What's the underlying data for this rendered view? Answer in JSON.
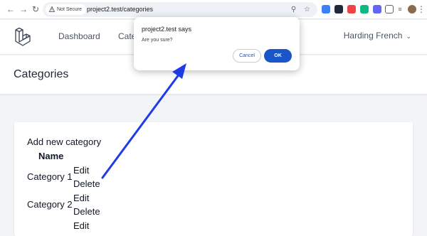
{
  "browser": {
    "security_label": "Not Secure",
    "url": "project2.test/categories",
    "icons": [
      "back-icon",
      "forward-icon",
      "reload-icon",
      "zoom-icon",
      "bookmark-star-icon",
      "extensions-icon",
      "profile-avatar-icon",
      "menu-kebab-icon"
    ]
  },
  "header": {
    "nav": [
      "Dashboard",
      "Cate"
    ],
    "user_name": "Harding French"
  },
  "page": {
    "title": "Categories"
  },
  "content": {
    "add_link": "Add new category",
    "column_name": "Name",
    "rows": [
      {
        "name": "Category 1",
        "edit": "Edit",
        "delete": "Delete"
      },
      {
        "name": "Category 2",
        "edit": "Edit",
        "delete": "Delete"
      },
      {
        "name": "",
        "edit": "Edit",
        "delete": ""
      }
    ]
  },
  "dialog": {
    "title": "project2.test says",
    "message": "Are you sure?",
    "cancel_label": "Cancel",
    "ok_label": "OK"
  },
  "annotation": {
    "arrow_color": "#1f3be8"
  },
  "colors": {
    "primary_button": "#1a56c7",
    "page_background": "#f3f4f6"
  }
}
